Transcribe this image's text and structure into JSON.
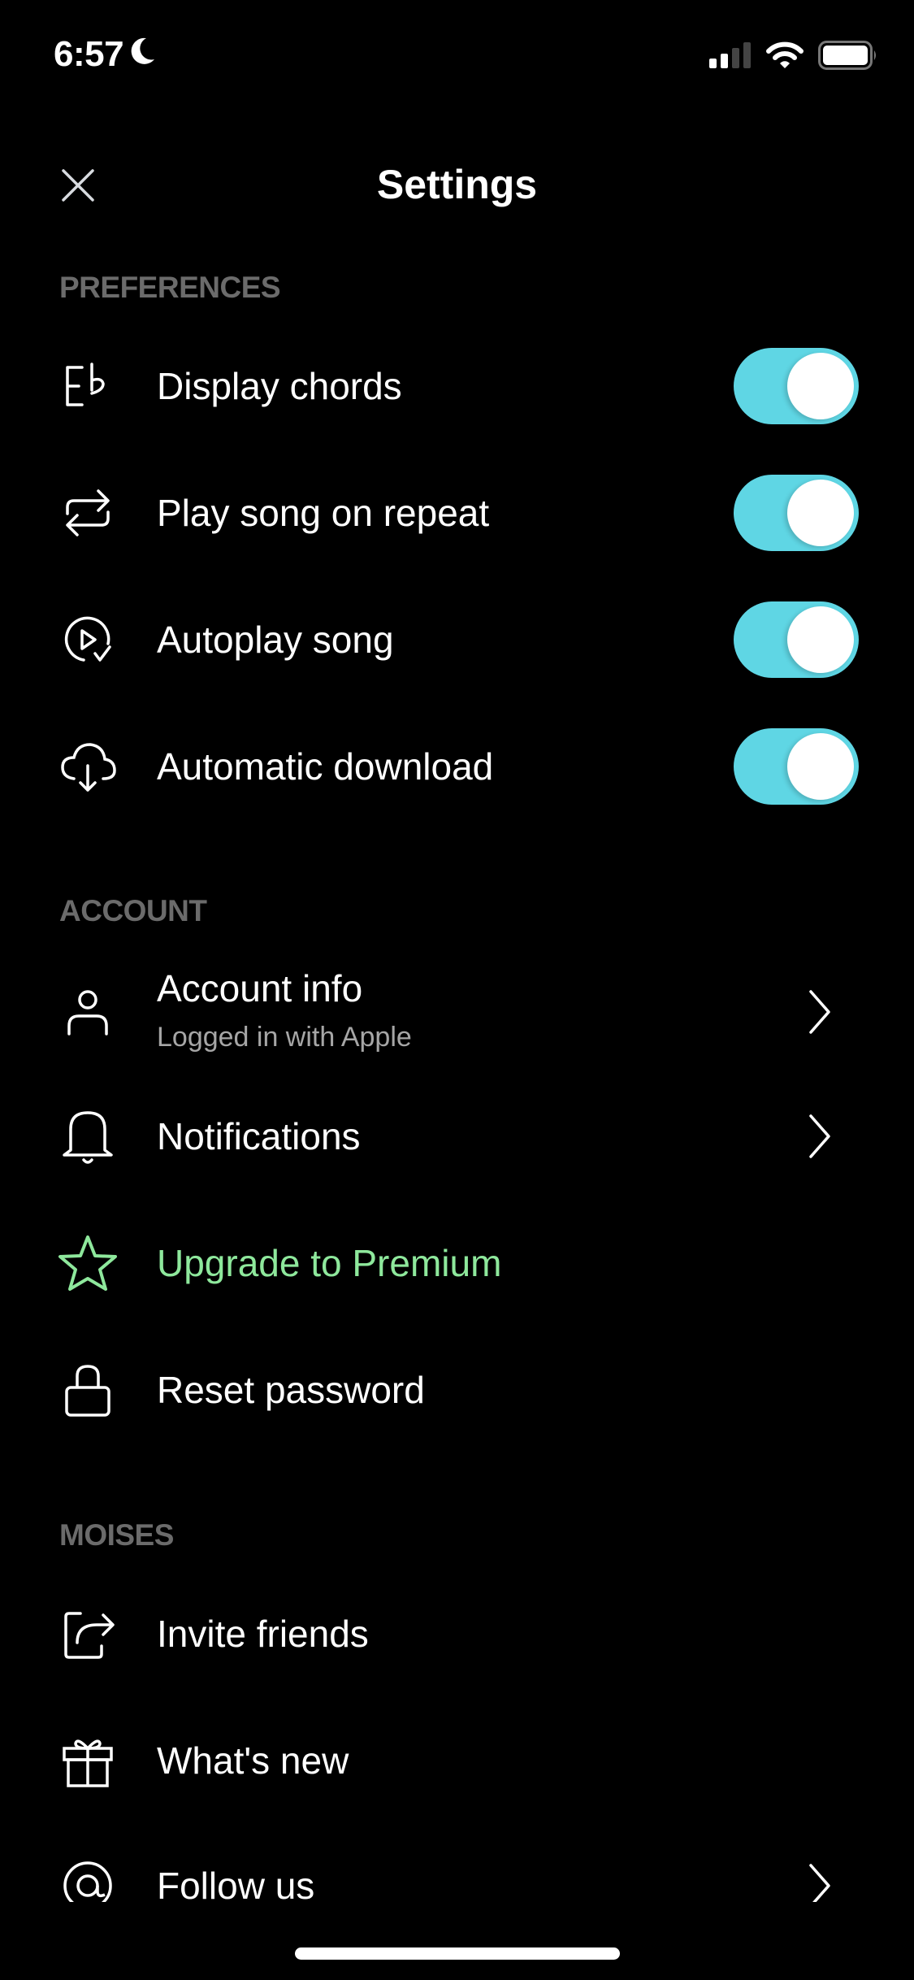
{
  "status_bar": {
    "time": "6:57",
    "focus_icon": "moon-icon",
    "signal_icon": "cellular-signal-icon",
    "wifi_icon": "wifi-icon",
    "battery_icon": "battery-icon"
  },
  "nav": {
    "title": "Settings",
    "close_icon": "close-icon"
  },
  "accent_colors": {
    "toggle_on": "#5fd6e4",
    "premium": "#8ee89c",
    "section_header": "#6b6b6b",
    "subtitle": "#a6a6a6"
  },
  "sections": {
    "preferences": {
      "header": "PREFERENCES",
      "items": [
        {
          "label": "Display chords",
          "icon": "chord-eb-icon",
          "toggle": true
        },
        {
          "label": "Play song on repeat",
          "icon": "repeat-icon",
          "toggle": true
        },
        {
          "label": "Autoplay song",
          "icon": "autoplay-icon",
          "toggle": true
        },
        {
          "label": "Automatic download",
          "icon": "cloud-download-icon",
          "toggle": true
        }
      ]
    },
    "account": {
      "header": "ACCOUNT",
      "items": [
        {
          "label": "Account info",
          "subtitle": "Logged in with Apple",
          "icon": "user-icon",
          "chevron": true
        },
        {
          "label": "Notifications",
          "icon": "bell-icon",
          "chevron": true
        },
        {
          "label": "Upgrade to Premium",
          "icon": "star-icon",
          "chevron": false
        },
        {
          "label": "Reset password",
          "icon": "lock-icon",
          "chevron": false
        }
      ]
    },
    "moises": {
      "header": "MOISES",
      "items": [
        {
          "label": "Invite friends",
          "icon": "share-icon",
          "chevron": false
        },
        {
          "label": "What's new",
          "icon": "gift-icon",
          "chevron": false
        },
        {
          "label": "Follow us",
          "icon": "at-sign-icon",
          "chevron": true
        }
      ]
    }
  }
}
